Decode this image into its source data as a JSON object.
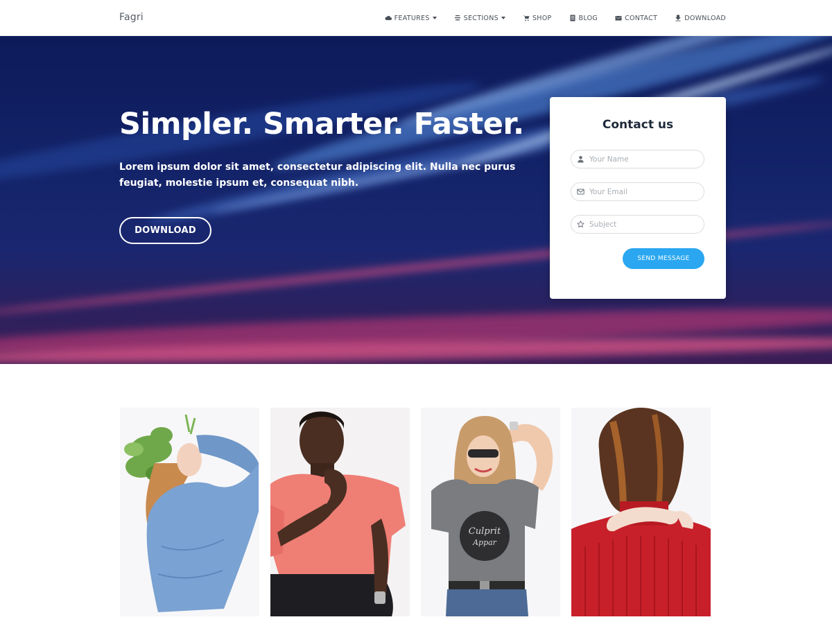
{
  "nav": {
    "brand": "Fagri",
    "items": [
      {
        "label": "FEATURES",
        "icon": "cloud-icon",
        "dropdown": true
      },
      {
        "label": "SECTIONS",
        "icon": "list-icon",
        "dropdown": true
      },
      {
        "label": "SHOP",
        "icon": "cart-icon",
        "dropdown": false
      },
      {
        "label": "BLOG",
        "icon": "document-icon",
        "dropdown": false
      },
      {
        "label": "CONTACT",
        "icon": "envelope-icon",
        "dropdown": false
      },
      {
        "label": "DOWNLOAD",
        "icon": "download-icon",
        "dropdown": false
      }
    ]
  },
  "hero": {
    "title": "Simpler. Smarter. Faster.",
    "text": "Lorem ipsum dolor sit amet, consectetur adipiscing elit. Nulla nec purus feugiat, molestie ipsum et, consequat nibh.",
    "button": "DOWNLOAD"
  },
  "contact": {
    "title": "Contact us",
    "name_placeholder": "Your Name",
    "email_placeholder": "Your Email",
    "subject_placeholder": "Subject",
    "send_button": "SEND MESSAGE"
  },
  "gallery": {
    "photos": [
      {
        "subject": "woman in blue sweater with leaves on head"
      },
      {
        "subject": "man in pink t-shirt"
      },
      {
        "subject": "woman in grey t-shirt with sunglasses"
      },
      {
        "subject": "woman in red sweater from behind"
      }
    ]
  },
  "colors": {
    "accent": "#2aa7f0",
    "hero_dark": "#0d1a5a",
    "hero_pink": "#e0457a",
    "text_dark": "#1f2a3a"
  }
}
